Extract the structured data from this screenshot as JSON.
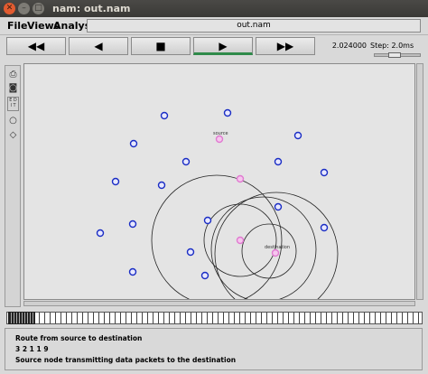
{
  "window": {
    "title": "nam: out.nam",
    "close_glyph": "✕",
    "min_glyph": "–",
    "max_glyph": "□"
  },
  "menu": {
    "items": [
      "File",
      "Views",
      "Analysis"
    ],
    "filename": "out.nam"
  },
  "controls": {
    "rewind": "◀◀",
    "back": "◀",
    "stop": "■",
    "play": "▶",
    "fastforward": "▶▶",
    "time": "2.024000",
    "step": "Step: 2.0ms"
  },
  "tools": [
    "printer-icon",
    "camera-icon",
    "edit-icon",
    "circle-icon",
    "diamond-icon"
  ],
  "tool_labels": {
    "edit": "E D I T"
  },
  "network": {
    "node_colors": {
      "blue": "#1a2dc4",
      "pink": "#e07ad0"
    },
    "labels": {
      "source": "source",
      "destination": "destination"
    }
  },
  "log": {
    "lines": [
      "Route from source to destination",
      "3 2 1 1 9",
      "Source node transmitting data packets to the destination"
    ]
  }
}
